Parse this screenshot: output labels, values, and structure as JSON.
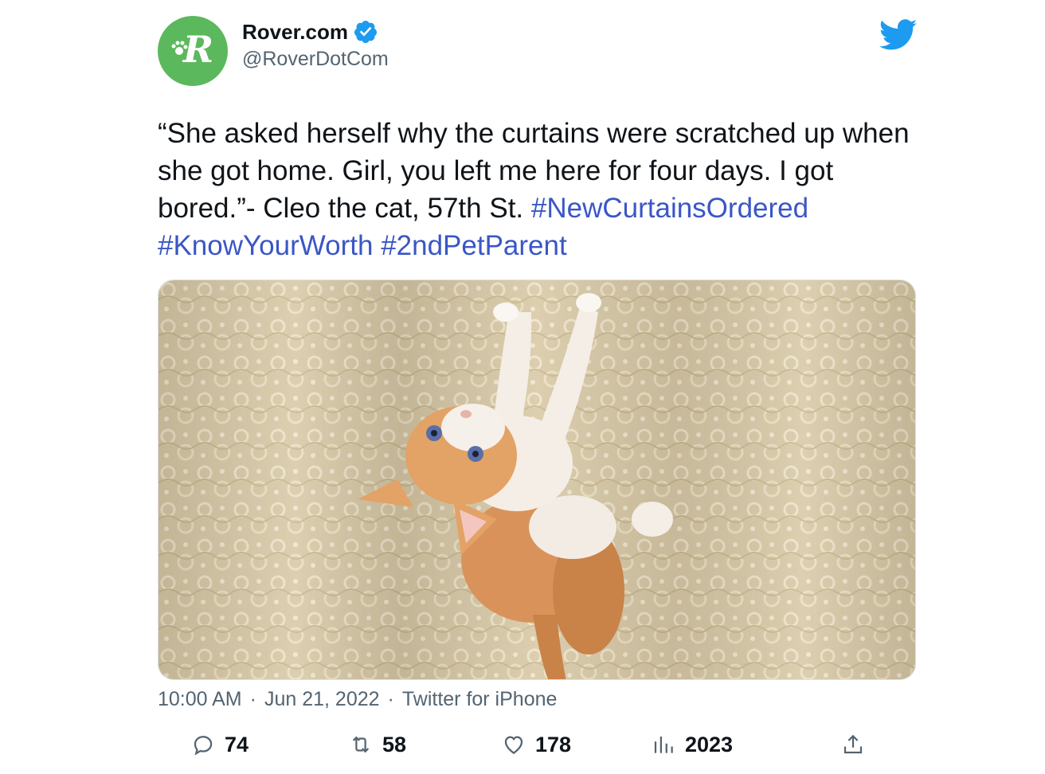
{
  "header": {
    "display_name": "Rover.com",
    "handle": "@RoverDotCom",
    "avatar_letter": "R",
    "avatar_color": "#5cb85c",
    "verified_icon": "verified-badge-icon",
    "brand_icon": "twitter-bird-icon"
  },
  "tweet": {
    "text_part1": "“She asked herself why the curtains were scratched up when she got home. Girl, you left me here for four days. I got bored.”- Cleo the cat, 57th St. ",
    "hashtags": [
      "#NewCurtainsOrdered",
      "#KnowYourWorth",
      "#2ndPetParent"
    ],
    "image_alt": "Orange and white kitten climbing lace curtains"
  },
  "meta": {
    "time": "10:00 AM",
    "date": "Jun 21, 2022",
    "source": "Twitter for iPhone",
    "separator": "·"
  },
  "actions": {
    "reply": "74",
    "retweet": "58",
    "like": "178",
    "views": "2023"
  },
  "colors": {
    "hashtag": "#3a56c6",
    "twitter_blue": "#1d9bf0",
    "muted": "#536471"
  }
}
